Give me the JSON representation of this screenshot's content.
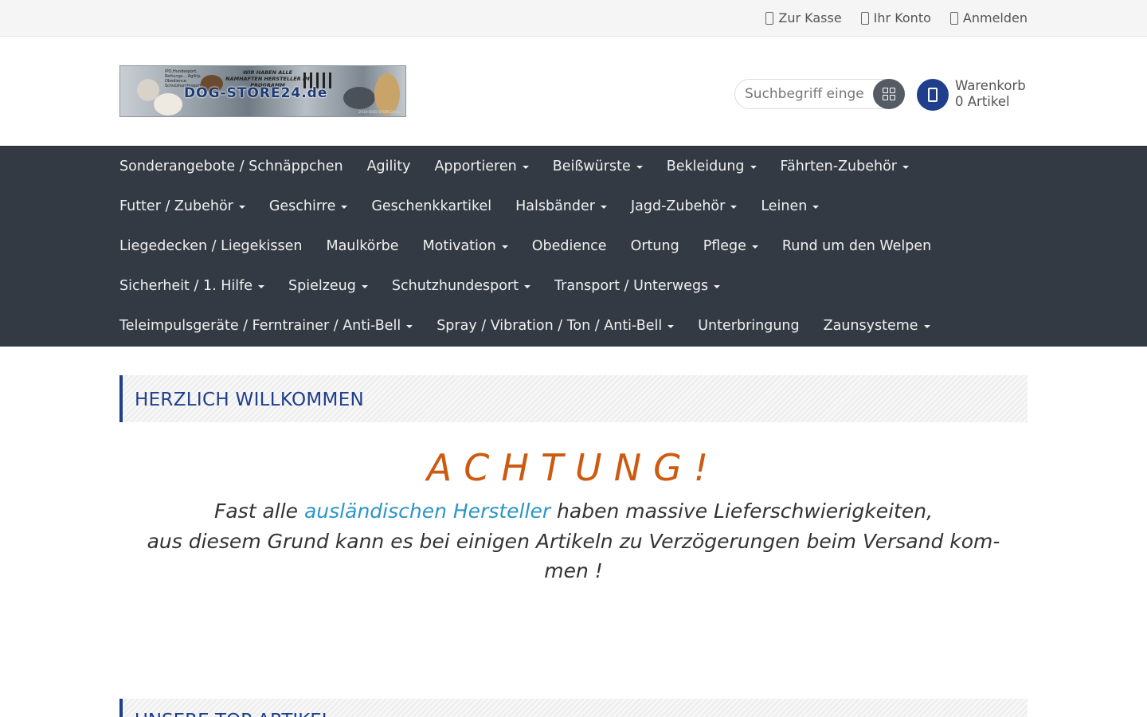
{
  "topbar": {
    "links": [
      {
        "label": "Zur Kasse",
        "icon": "checkout-icon"
      },
      {
        "label": "Ihr Konto",
        "icon": "account-icon"
      },
      {
        "label": "Anmelden",
        "icon": "login-icon"
      }
    ]
  },
  "header": {
    "logo": {
      "brand": "DOG-STORE24.de",
      "tagline": "WIR HABEN ALLE NAMHAFTEN HERSTELLER IM PROGRAMM",
      "tiny": "IPO,Hundesport, Rettungs... Agility, Obedience Schutzhundesport",
      "footer": "2010 DOG-STORE24.de"
    },
    "search": {
      "placeholder": "Suchbegriff eingeben",
      "icon": "search-grid-icon"
    },
    "cart": {
      "label": "Warenkorb",
      "count_text": "0 Artikel",
      "icon": "cart-icon"
    }
  },
  "nav": {
    "rows": [
      [
        {
          "label": "Sonderangebote / Schnäppchen",
          "dropdown": false
        },
        {
          "label": "Agility",
          "dropdown": false
        },
        {
          "label": "Apportieren",
          "dropdown": true
        },
        {
          "label": "Beißwürste",
          "dropdown": true
        },
        {
          "label": "Bekleidung",
          "dropdown": true
        },
        {
          "label": "Fährten-Zubehör",
          "dropdown": true
        }
      ],
      [
        {
          "label": "Futter / Zubehör",
          "dropdown": true
        },
        {
          "label": "Geschirre",
          "dropdown": true
        },
        {
          "label": "Geschenkkartikel",
          "dropdown": false
        },
        {
          "label": "Halsbänder",
          "dropdown": true
        },
        {
          "label": "Jagd-Zubehör",
          "dropdown": true
        },
        {
          "label": "Leinen",
          "dropdown": true
        }
      ],
      [
        {
          "label": "Liegedecken / Liegekissen",
          "dropdown": false
        },
        {
          "label": "Maulkörbe",
          "dropdown": false
        },
        {
          "label": "Motivation",
          "dropdown": true
        },
        {
          "label": "Obedience",
          "dropdown": false
        },
        {
          "label": "Ortung",
          "dropdown": false
        },
        {
          "label": "Pflege",
          "dropdown": true
        },
        {
          "label": "Rund um den Welpen",
          "dropdown": false
        }
      ],
      [
        {
          "label": "Sicherheit / 1. Hilfe",
          "dropdown": true
        },
        {
          "label": "Spielzeug",
          "dropdown": true
        },
        {
          "label": "Schutzhundesport",
          "dropdown": true
        },
        {
          "label": "Transport / Unterwegs",
          "dropdown": true
        }
      ],
      [
        {
          "label": "Teleimpulsgeräte / Ferntrainer / Anti-Bell",
          "dropdown": true
        },
        {
          "label": "Spray / Vibration / Ton / Anti-Bell",
          "dropdown": true
        },
        {
          "label": "Unterbringung",
          "dropdown": false
        },
        {
          "label": "Zaunsysteme",
          "dropdown": true
        }
      ]
    ]
  },
  "welcome": {
    "title": "HERZLICH WILLKOMMEN",
    "achtung": "ACHTUNG!",
    "notice_line1_pre": "Fast alle ",
    "notice_link": "ausländischen Hersteller",
    "notice_line1_post": " haben massive Lieferschwierigkeiten,",
    "notice_line2": "aus diesem Grund kann es bei einigen Artikeln zu Verzögerungen beim Versand kom-",
    "notice_line3": "men !"
  },
  "top_articles": {
    "title": "UNSERE TOP-ARTIKEL"
  },
  "colors": {
    "nav_bg": "#343a43",
    "brand_blue": "#1f3f8c",
    "achtung_orange": "#cc5a10",
    "link_blue": "#2b95c8"
  }
}
